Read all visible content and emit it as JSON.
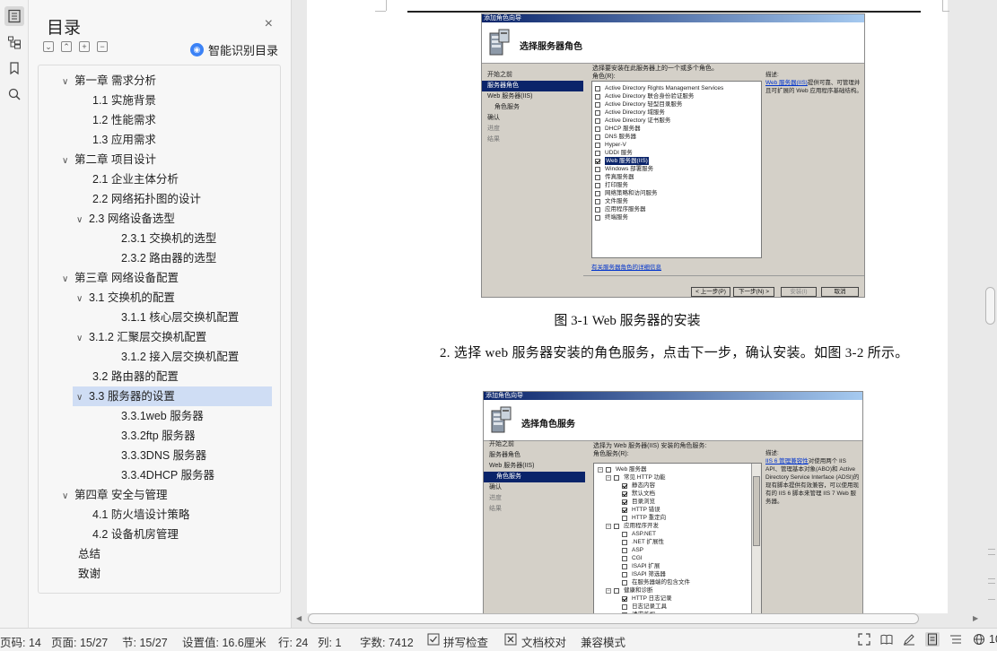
{
  "toc": {
    "title": "目录",
    "close": "×",
    "smart_label": "智能识别目录",
    "items": [
      {
        "label": "第一章 需求分析",
        "level": 1,
        "chev": "∨"
      },
      {
        "label": "1.1 实施背景",
        "level": 2,
        "chev": ""
      },
      {
        "label": "1.2 性能需求",
        "level": 2,
        "chev": ""
      },
      {
        "label": "1.3 应用需求",
        "level": 2,
        "chev": ""
      },
      {
        "label": "第二章 项目设计",
        "level": 1,
        "chev": "∨"
      },
      {
        "label": "2.1 企业主体分析",
        "level": 2,
        "chev": ""
      },
      {
        "label": "2.2 网络拓扑图的设计",
        "level": 2,
        "chev": ""
      },
      {
        "label": "2.3 网络设备选型",
        "level": 2,
        "chev": "∨"
      },
      {
        "label": "2.3.1 交换机的选型",
        "level": 3,
        "chev": ""
      },
      {
        "label": "2.3.2 路由器的选型",
        "level": 3,
        "chev": ""
      },
      {
        "label": "第三章 网络设备配置",
        "level": 1,
        "chev": "∨"
      },
      {
        "label": "3.1 交换机的配置",
        "level": 2,
        "chev": "∨"
      },
      {
        "label": "3.1.1 核心层交换机配置",
        "level": 3,
        "chev": ""
      },
      {
        "label": "3.1.2 汇聚层交换机配置",
        "level": 2,
        "chev": "∨"
      },
      {
        "label": "3.1.2 接入层交换机配置",
        "level": 3,
        "chev": ""
      },
      {
        "label": "3.2 路由器的配置",
        "level": 2,
        "chev": ""
      },
      {
        "label": "3.3 服务器的设置",
        "level": 2,
        "chev": "∨",
        "selected": true
      },
      {
        "label": "3.3.1web 服务器",
        "level": 3,
        "chev": ""
      },
      {
        "label": "3.3.2ftp 服务器",
        "level": 3,
        "chev": ""
      },
      {
        "label": "3.3.3DNS 服务器",
        "level": 3,
        "chev": ""
      },
      {
        "label": "3.3.4DHCP 服务器",
        "level": 3,
        "chev": ""
      },
      {
        "label": "第四章 安全与管理",
        "level": 1,
        "chev": "∨"
      },
      {
        "label": "4.1 防火墙设计策略",
        "level": 2,
        "chev": ""
      },
      {
        "label": "4.2 设备机房管理",
        "level": 2,
        "chev": ""
      },
      {
        "label": "总结",
        "level": 1,
        "chev": ""
      },
      {
        "label": "致谢",
        "level": 1,
        "chev": ""
      }
    ]
  },
  "dialog1": {
    "titlebar": "添加角色向导",
    "heading": "选择服务器角色",
    "nav": [
      "开始之前",
      "服务器角色",
      "Web 服务器(IIS)",
      "角色服务",
      "确认",
      "进度",
      "结果"
    ],
    "instruction": "选择要安装在此服务器上的一个或多个角色。",
    "roles_label": "角色(R):",
    "roles": [
      {
        "label": "Active Directory Rights Management Services",
        "checked": false
      },
      {
        "label": "Active Directory 联合身份验证服务",
        "checked": false
      },
      {
        "label": "Active Directory 轻型目录服务",
        "checked": false
      },
      {
        "label": "Active Directory 域服务",
        "checked": false
      },
      {
        "label": "Active Directory 证书服务",
        "checked": false
      },
      {
        "label": "DHCP 服务器",
        "checked": false
      },
      {
        "label": "DNS 服务器",
        "checked": false
      },
      {
        "label": "Hyper-V",
        "checked": false
      },
      {
        "label": "UDDI 服务",
        "checked": false
      },
      {
        "label": "Web 服务器(IIS)",
        "checked": true,
        "highlight": true
      },
      {
        "label": "Windows 部署服务",
        "checked": false
      },
      {
        "label": "传真服务器",
        "checked": false
      },
      {
        "label": "打印服务",
        "checked": false
      },
      {
        "label": "网络策略和访问服务",
        "checked": false
      },
      {
        "label": "文件服务",
        "checked": false
      },
      {
        "label": "应用程序服务器",
        "checked": false
      },
      {
        "label": "终端服务",
        "checked": false
      }
    ],
    "desc_title": "描述:",
    "desc_link": "Web 服务器(IIS)",
    "desc_text": "提供可靠、可管理并且可扩展的 Web 应用程序基础结构。",
    "more_link": "有关服务器角色的详细信息",
    "buttons": {
      "prev": "< 上一步(P)",
      "next": "下一步(N) >",
      "install": "安装(I)",
      "cancel": "取消"
    }
  },
  "caption1": "图 3-1 Web 服务器的安装",
  "paragraph": "2. 选择 web 服务器安装的角色服务，点击下一步，确认安装。如图 3-2 所示。",
  "dialog2": {
    "titlebar": "添加角色向导",
    "heading": "选择角色服务",
    "nav": [
      "开始之前",
      "服务器角色",
      "Web 服务器(IIS)",
      "角色服务",
      "确认",
      "进度",
      "结果"
    ],
    "instruction": "选择为 Web 服务器(IIS) 安装的角色服务:",
    "services_label": "角色服务(R):",
    "tree": [
      {
        "label": "Web 服务器",
        "indent": 0,
        "expand": "−",
        "checked": false
      },
      {
        "label": "常见 HTTP 功能",
        "indent": 1,
        "expand": "−",
        "checked": false
      },
      {
        "label": "静态内容",
        "indent": 2,
        "checked": true
      },
      {
        "label": "默认文档",
        "indent": 2,
        "checked": true
      },
      {
        "label": "目录浏览",
        "indent": 2,
        "checked": true
      },
      {
        "label": "HTTP 错误",
        "indent": 2,
        "checked": true
      },
      {
        "label": "HTTP 重定向",
        "indent": 2,
        "checked": false
      },
      {
        "label": "应用程序开发",
        "indent": 1,
        "expand": "−",
        "checked": false
      },
      {
        "label": "ASP.NET",
        "indent": 2,
        "checked": false
      },
      {
        "label": ".NET 扩展性",
        "indent": 2,
        "checked": false
      },
      {
        "label": "ASP",
        "indent": 2,
        "checked": false
      },
      {
        "label": "CGI",
        "indent": 2,
        "checked": false
      },
      {
        "label": "ISAPI 扩展",
        "indent": 2,
        "checked": false
      },
      {
        "label": "ISAPI 筛选器",
        "indent": 2,
        "checked": false
      },
      {
        "label": "在服务器端的包含文件",
        "indent": 2,
        "checked": false
      },
      {
        "label": "健康和诊断",
        "indent": 1,
        "expand": "−",
        "checked": false
      },
      {
        "label": "HTTP 日志记录",
        "indent": 2,
        "checked": true
      },
      {
        "label": "日志记录工具",
        "indent": 2,
        "checked": false
      },
      {
        "label": "请求监视",
        "indent": 2,
        "checked": true
      }
    ],
    "desc_title": "描述:",
    "desc_link": "IIS 6 管理兼容性",
    "desc_text": "对使用两个 IIS API、管理基本对象(ABO)和 Active Directory Service Interface (ADSI)的现有脚本提供有效兼容，可以使用现有的 IIS 6 脚本来管理 IIS 7 Web 服务器。"
  },
  "status": {
    "page_num": "页码: 14",
    "pages": "页面: 15/27",
    "section": "节: 15/27",
    "setting": "设置值: 16.6厘米",
    "row": "行: 24",
    "col": "列: 1",
    "words": "字数: 7412",
    "spell": "拼写检查",
    "proof": "文档校对",
    "compat": "兼容模式",
    "zoom": "100%"
  },
  "colors": {
    "selection": "#cfddf4",
    "wizard_title": "#0a246a",
    "dialog_bg": "#d4d0c8"
  }
}
